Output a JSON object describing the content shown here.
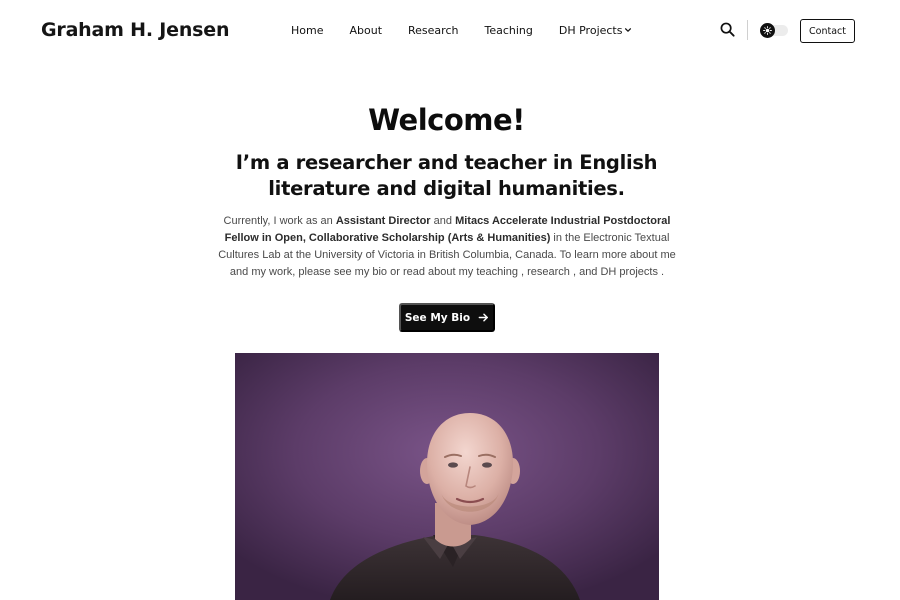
{
  "header": {
    "site_title": "Graham H. Jensen",
    "nav": [
      {
        "label": "Home"
      },
      {
        "label": "About"
      },
      {
        "label": "Research"
      },
      {
        "label": "Teaching"
      },
      {
        "label": "DH Projects",
        "has_dropdown": true
      }
    ],
    "search_icon": "search-icon",
    "theme_toggle_icon": "sun-icon",
    "contact_label": "Contact"
  },
  "hero": {
    "welcome": "Welcome!",
    "subtitle": "I’m a researcher and teacher in English literature and digital humanities.",
    "intro": {
      "t1": "Currently, I work as an ",
      "b1": "Assistant Director",
      "t2": " and ",
      "b2": "Mitacs Accelerate Industrial Postdoctoral Fellow in Open, Collaborative Scholarship (Arts & Humanities)",
      "t3": " in the Electronic Textual Cultures Lab at the University of Victoria in British Columbia, Canada. To learn more about me and my work, please see ",
      "link_bio": "my bio",
      "t4": " or read about ",
      "link_teaching": "my teaching",
      "t5": " , ",
      "link_research": "research",
      "t6": " , and ",
      "link_dh": "DH projects",
      "t7": " ."
    },
    "bio_button_label": "See My Bio",
    "bio_button_icon": "arrow-right-icon"
  },
  "colors": {
    "button_bg": "#0e0e0e",
    "portrait_bg": "#5a3a66"
  }
}
